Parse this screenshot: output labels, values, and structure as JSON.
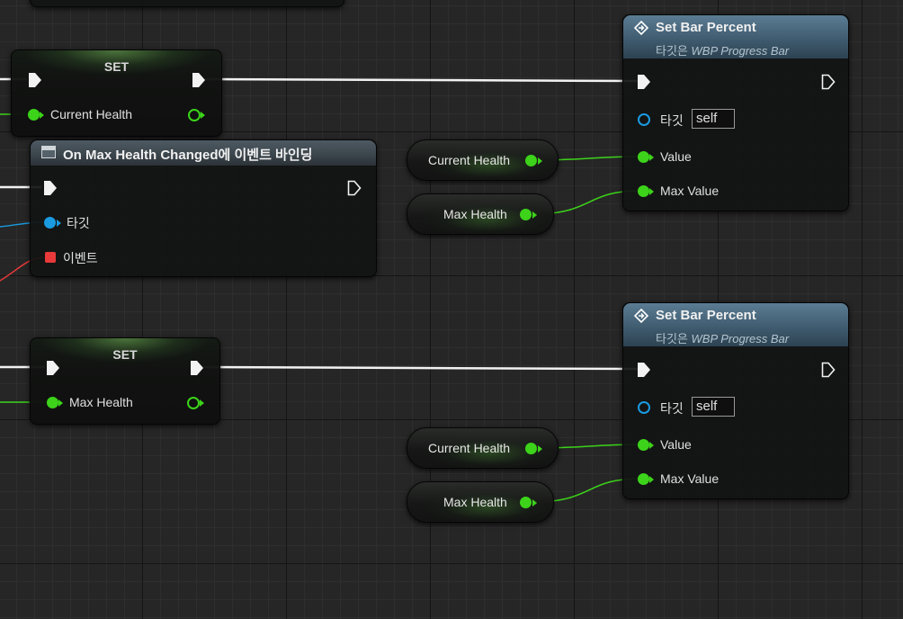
{
  "set_nodes": [
    {
      "title": "SET",
      "variable": "Current Health"
    },
    {
      "title": "SET",
      "variable": "Max Health"
    }
  ],
  "bind_event_node": {
    "title": "On Max Health Changed에 이벤트 바인딩",
    "target_label": "타깃",
    "event_label": "이벤트"
  },
  "set_bar_percent_nodes": [
    {
      "title": "Set Bar Percent",
      "subtitle_prefix": "타깃은 ",
      "subtitle_target": "WBP Progress Bar",
      "target_label": "타깃",
      "target_value": "self",
      "value_label": "Value",
      "max_value_label": "Max Value"
    },
    {
      "title": "Set Bar Percent",
      "subtitle_prefix": "타깃은 ",
      "subtitle_target": "WBP Progress Bar",
      "target_label": "타깃",
      "target_value": "self",
      "value_label": "Value",
      "max_value_label": "Max Value"
    }
  ],
  "getters": [
    {
      "label": "Current Health"
    },
    {
      "label": "Max Health"
    },
    {
      "label": "Current Health"
    },
    {
      "label": "Max Health"
    }
  ],
  "colors": {
    "exec": "#ffffff",
    "float_pin": "#3cd31a",
    "object_pin": "#1a9ae0",
    "delegate_pin": "#e83a3a",
    "function_header": "#4b6a80",
    "grid_bg": "#262626"
  }
}
